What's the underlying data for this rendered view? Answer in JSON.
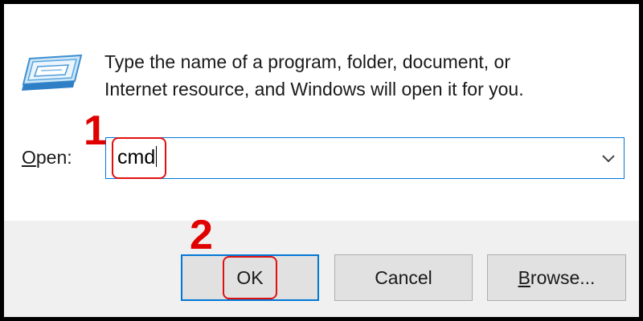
{
  "dialog": {
    "description_line1": "Type the name of a program, folder, document, or",
    "description_line2": "Internet resource, and Windows will open it for you.",
    "open_label_accel": "O",
    "open_label_rest": "pen:",
    "input_value": "cmd"
  },
  "buttons": {
    "ok_label": "OK",
    "cancel_label": "Cancel",
    "browse_label_accel": "B",
    "browse_label_rest": "rowse..."
  },
  "annotations": {
    "step1": "1",
    "step2": "2",
    "marker_color": "#e00000"
  },
  "icons": {
    "run": "run-program-icon",
    "dropdown": "chevron-down-icon"
  },
  "colors": {
    "accent": "#0078d7",
    "button_bg": "#e1e1e1",
    "footer_bg": "#f0f0f0"
  }
}
